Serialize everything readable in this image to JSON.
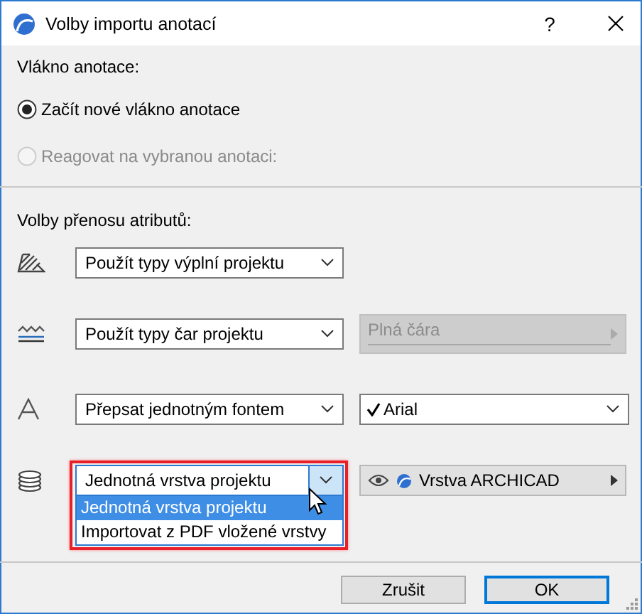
{
  "window": {
    "title": "Volby importu anotací",
    "help": "?"
  },
  "thread": {
    "label": "Vlákno anotace:",
    "options": [
      {
        "label": "Začít nové vlákno anotace",
        "selected": true,
        "disabled": false
      },
      {
        "label": "Reagovat na vybranou anotaci:",
        "selected": false,
        "disabled": true
      }
    ]
  },
  "attributes": {
    "label": "Volby přenosu atributů:",
    "rows": [
      {
        "kind": "fill",
        "select": "Použít typy výplní projektu",
        "highlighted": false,
        "expanded": false
      },
      {
        "kind": "line",
        "select": "Použít typy čar projektu",
        "highlighted": false,
        "expanded": false,
        "side": {
          "kind": "field",
          "text": "Plná čára",
          "disabled": true
        }
      },
      {
        "kind": "font",
        "select": "Přepsat jednotným fontem",
        "highlighted": false,
        "expanded": false,
        "side": {
          "kind": "dropdown",
          "text": "Arial",
          "checked": true
        }
      },
      {
        "kind": "layer",
        "select": "Jednotná vrstva projektu",
        "highlighted": true,
        "expanded": true,
        "options": [
          {
            "label": "Jednotná vrstva projektu",
            "selected": true
          },
          {
            "label": "Importovat z PDF vložené vrstvy",
            "selected": false
          }
        ],
        "side": {
          "kind": "layer",
          "text": "Vrstva ARCHICAD"
        }
      }
    ]
  },
  "buttons": [
    {
      "label": "Zrušit",
      "default": false
    },
    {
      "label": "OK",
      "default": true
    }
  ]
}
